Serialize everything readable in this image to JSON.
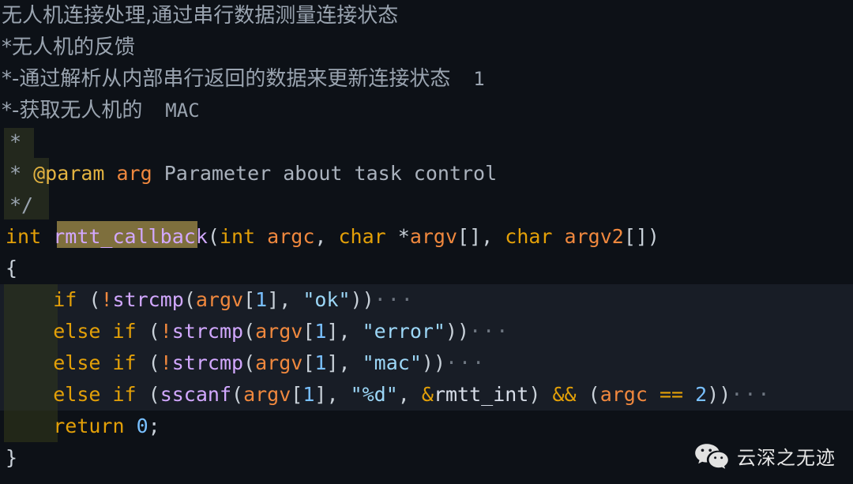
{
  "editor": {
    "background_color": "#0d1117",
    "block_background_color": "#181d26",
    "indent_guide_color": "#23281d",
    "word_highlight_color": "#7e6f3d",
    "language": "C"
  },
  "lines": [
    {
      "id": "line-1",
      "type": "comment-cjk",
      "text": "无人机连接处理,通过串行数据测量连接状态"
    },
    {
      "id": "line-2",
      "type": "comment-cjk",
      "text": "*无人机的反馈"
    },
    {
      "id": "line-3",
      "type": "comment-cjk",
      "prefix": "*-通过解析从内部串行返回的数据来更新连接状态",
      "suffix": "1"
    },
    {
      "id": "line-4",
      "type": "comment-cjk",
      "prefix": "*-获取无人机的",
      "suffix": "MAC"
    },
    {
      "id": "line-5",
      "type": "comment",
      "star": "*"
    },
    {
      "id": "line-6",
      "type": "comment-param",
      "star": "*",
      "tag": "@param",
      "param": "arg",
      "description": "Parameter about task control"
    },
    {
      "id": "line-7",
      "type": "comment",
      "star": "*/"
    },
    {
      "id": "line-8",
      "type": "signature",
      "return_type": "int",
      "name": "rmtt_callback",
      "params": "(int argc, char *argv[], char argv2[])"
    },
    {
      "id": "line-9",
      "type": "brace",
      "text": "{"
    },
    {
      "id": "line-10",
      "type": "if",
      "keyword": "if",
      "call": "strcmp",
      "arg": "argv",
      "index": "1",
      "string": "\"ok\"",
      "fold": "···"
    },
    {
      "id": "line-11",
      "type": "elseif",
      "keyword": "else if",
      "call": "strcmp",
      "arg": "argv",
      "index": "1",
      "string": "\"error\"",
      "fold": "···"
    },
    {
      "id": "line-12",
      "type": "elseif",
      "keyword": "else if",
      "call": "strcmp",
      "arg": "argv",
      "index": "1",
      "string": "\"mac\"",
      "fold": "···"
    },
    {
      "id": "line-13",
      "type": "elseif-sscanf",
      "keyword": "else if",
      "call": "sscanf",
      "arg": "argv",
      "index": "1",
      "string": "\"%d\"",
      "ampersand": "&",
      "variable": "rmtt_int",
      "logic_op": "&&",
      "arg2": "argc",
      "compare_op": "==",
      "number": "2",
      "fold": "···"
    },
    {
      "id": "line-14",
      "type": "return",
      "keyword": "return",
      "value": "0",
      "semicolon": ";"
    },
    {
      "id": "line-15",
      "type": "brace",
      "text": "}"
    }
  ],
  "watermark": {
    "icon": "wechat-icon",
    "text": "云深之无迹"
  }
}
